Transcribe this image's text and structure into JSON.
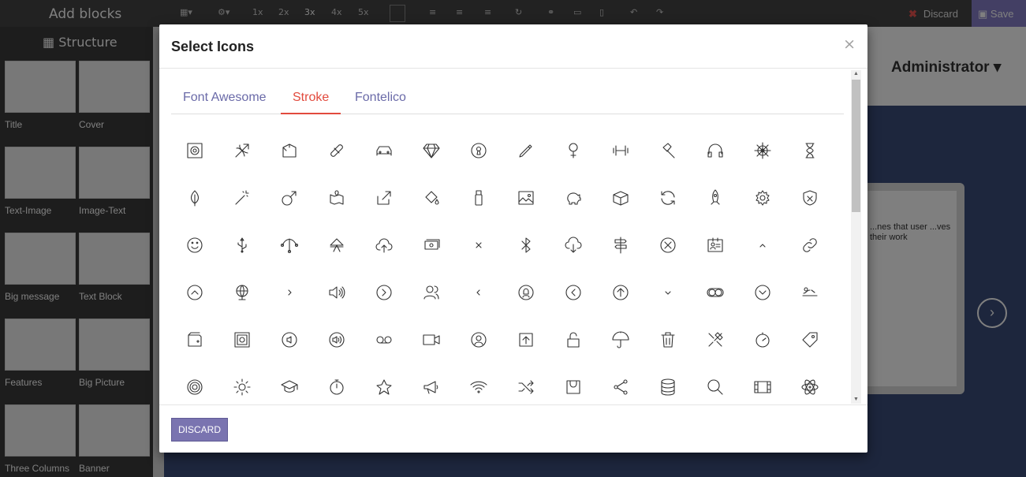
{
  "editor": {
    "title": "Add blocks",
    "tools": [
      "1x",
      "2x",
      "3x",
      "4x",
      "5x"
    ],
    "discard_label": "Discard",
    "save_label": "Save",
    "user_menu": "Administrator",
    "sidebar_heading": "Structure",
    "snippets": [
      "Title",
      "Cover",
      "Text-Image",
      "Image-Text",
      "Big message",
      "Text Block",
      "Features",
      "Big Picture",
      "Three Columns",
      "Banner"
    ],
    "preview_text": "...nes that user ...ves their work"
  },
  "modal": {
    "title": "Select Icons",
    "close_glyph": "×",
    "tabs": [
      {
        "label": "Font Awesome",
        "active": false
      },
      {
        "label": "Stroke",
        "active": true
      },
      {
        "label": "Fontelico",
        "active": false
      }
    ],
    "icons": [
      "speaker-icon",
      "bow-icon",
      "box-open-icon",
      "bandage-icon",
      "car-icon",
      "diamond-icon",
      "keyhole-icon",
      "pen-icon",
      "female-icon",
      "dumbbell-icon",
      "hammer-icon",
      "headphones-icon",
      "helm-icon",
      "hourglass-icon",
      "leaf-icon",
      "magic-wand-icon",
      "male-icon",
      "map-icon",
      "share-box-icon",
      "paint-bucket-icon",
      "usb-drive-icon",
      "photo-icon",
      "piggy-bank-icon",
      "package-icon",
      "refresh-icon",
      "rocket-icon",
      "settings-icon",
      "shield-icon",
      "smile-icon",
      "usb-icon",
      "vector-icon",
      "cone-icon",
      "cloud-upload-icon",
      "cash-icon",
      "close-icon",
      "bluetooth-icon",
      "cloud-download-icon",
      "signpost-icon",
      "close-circle-icon",
      "id-card-icon",
      "chevron-up-icon",
      "link-icon",
      "arrow-up-circle-icon",
      "globe-icon",
      "chevron-right-icon",
      "volume-icon",
      "arrow-right-circle-icon",
      "users-icon",
      "chevron-left-icon",
      "user-female-icon",
      "arrow-left-circle-icon",
      "arrow-up-circle2-icon",
      "chevron-down-icon",
      "toggle-icon",
      "arrow-down-circle-icon",
      "sleep-icon",
      "wallet-icon",
      "safe-icon",
      "volume-down-icon",
      "volume-up-icon",
      "voicemail-icon",
      "video-icon",
      "user-icon",
      "upload-icon",
      "unlock-icon",
      "umbrella-icon",
      "trash-icon",
      "tools-icon",
      "timer-icon",
      "tag-icon",
      "target-icon",
      "sun-icon",
      "graduation-icon",
      "stopwatch-icon",
      "star-icon",
      "megaphone-icon",
      "wifi-icon",
      "shuffle-icon",
      "shopping-bag-icon",
      "share-icon",
      "database-icon",
      "search-icon",
      "film-icon",
      "atom-icon"
    ],
    "discard_label": "DISCARD"
  }
}
